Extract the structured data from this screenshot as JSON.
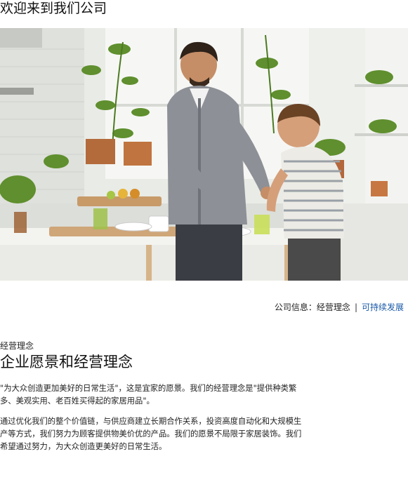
{
  "page": {
    "title": "欢迎来到我们公司"
  },
  "hero": {
    "alt": "父亲与孩子在厨房里准备早餐"
  },
  "breadcrumb": {
    "section": "公司信息：经营理念",
    "separator": "|",
    "link": "可持续发展"
  },
  "content": {
    "kicker": "经营理念",
    "heading": "企业愿景和经营理念",
    "paragraphs": [
      "\"为大众创造更加美好的日常生活\"，这是宜家的愿景。我们的经营理念是\"提供种类繁多、美观实用、老百姓买得起的家居用品\"。",
      "通过优化我们的整个价值链，与供应商建立长期合作关系，投资高度自动化和大规模生产等方式，我们努力为顾客提供物美价优的产品。我们的愿景不局限于家居装饰。我们希望通过努力，为大众创造更美好的日常生活。"
    ]
  },
  "colors": {
    "link": "#1a5aa8",
    "text": "#222222"
  }
}
